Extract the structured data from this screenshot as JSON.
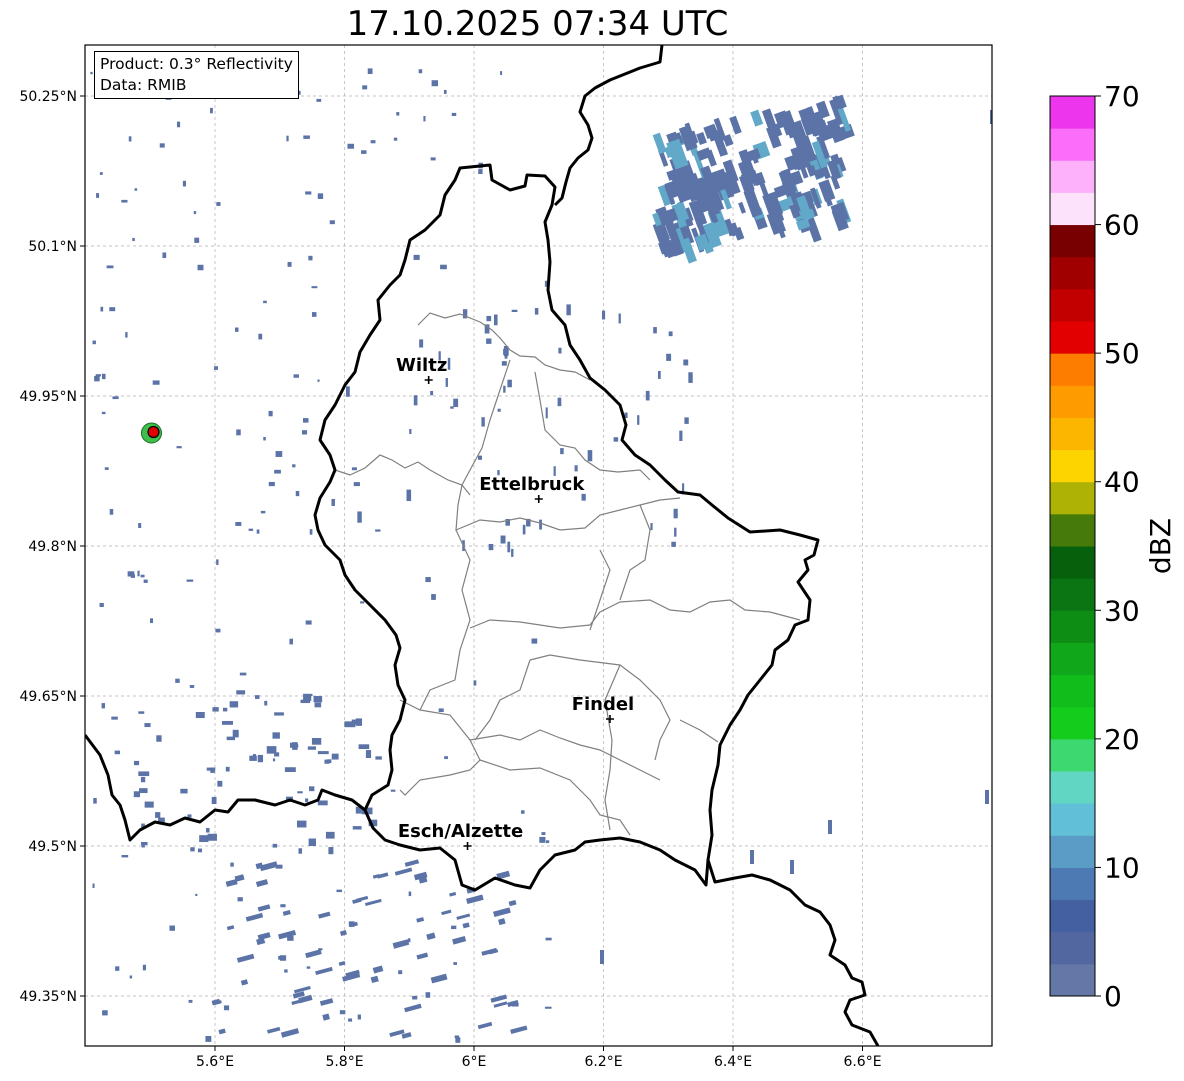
{
  "title": "17.10.2025 07:34 UTC",
  "info": {
    "product": "Product: 0.3° Reflectivity",
    "data": "Data: RMIB"
  },
  "map": {
    "lon_ticks": [
      "5.6°E",
      "5.8°E",
      "6°E",
      "6.2°E",
      "6.4°E",
      "6.6°E"
    ],
    "lat_ticks": [
      "50.25°N",
      "50.1°N",
      "49.95°N",
      "49.8°N",
      "49.65°N",
      "49.5°N",
      "49.35°N"
    ],
    "extent": {
      "lon": [
        5.4,
        6.8
      ],
      "lat": [
        49.3,
        50.3
      ]
    },
    "cities": [
      {
        "name": "Wiltz",
        "lon": 5.93,
        "lat": 49.966
      },
      {
        "name": "Ettelbruck",
        "lon": 6.1,
        "lat": 49.847
      },
      {
        "name": "Findel",
        "lon": 6.21,
        "lat": 49.627
      },
      {
        "name": "Esch/Alzette",
        "lon": 5.99,
        "lat": 49.5
      }
    ],
    "radar_site": {
      "lon": 5.505,
      "lat": 49.914
    }
  },
  "colorbar": {
    "label": "dBZ",
    "ticks": [
      "0",
      "10",
      "20",
      "30",
      "40",
      "50",
      "60",
      "70"
    ],
    "range": [
      0,
      70
    ],
    "colors": [
      "#6577a6",
      "#52679f",
      "#4560a0",
      "#4d7ab3",
      "#5a9cc6",
      "#62bfd8",
      "#61d7c3",
      "#3dd86f",
      "#14cc1c",
      "#10bd1a",
      "#10a71a",
      "#0e8d15",
      "#0a7512",
      "#06600c",
      "#467a0a",
      "#adb205",
      "#fdd400",
      "#fdb600",
      "#fd9b00",
      "#fd7d00",
      "#e20000",
      "#c20000",
      "#a00000",
      "#780000",
      "#fde2fc",
      "#feb1fb",
      "#fc6ef9",
      "#ec35ec"
    ]
  },
  "colors": {
    "echo": "#5b73a6",
    "echo_light": "#62a8c8",
    "border": "#000000",
    "canton": "#808080",
    "grid": "#b0b0b0"
  }
}
